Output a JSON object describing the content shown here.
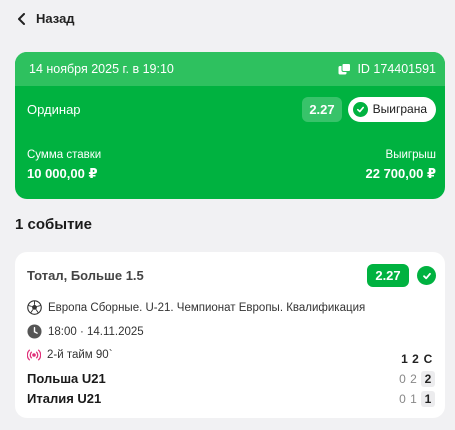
{
  "nav": {
    "back_label": "Назад"
  },
  "bet": {
    "date": "14 ноября 2025 г. в 19:10",
    "id": "ID 174401591",
    "type": "Ординар",
    "odds": "2.27",
    "status": "Выиграна",
    "stake_label": "Сумма ставки",
    "stake_value": "10 000,00 ₽",
    "payout_label": "Выигрыш",
    "payout_value": "22 700,00 ₽"
  },
  "events_title": "1 событие",
  "event": {
    "market": "Тотал, Больше 1.5",
    "odds": "2.27",
    "tournament": "Европа Сборные. U-21. Чемпионат Европы. Квалификация",
    "start_time": "18:00 · 14.11.2025",
    "live_status": "2-й тайм 90`",
    "score_headers": [
      "1",
      "2",
      "С"
    ],
    "teams": [
      {
        "name": "Польша U21",
        "scores": [
          "0",
          "2",
          "2"
        ]
      },
      {
        "name": "Италия U21",
        "scores": [
          "0",
          "1",
          "1"
        ]
      }
    ]
  },
  "colors": {
    "accent": "#00b240",
    "accent_light": "#2ec15f",
    "background": "#f1f1f3",
    "live": "#e0317a"
  }
}
